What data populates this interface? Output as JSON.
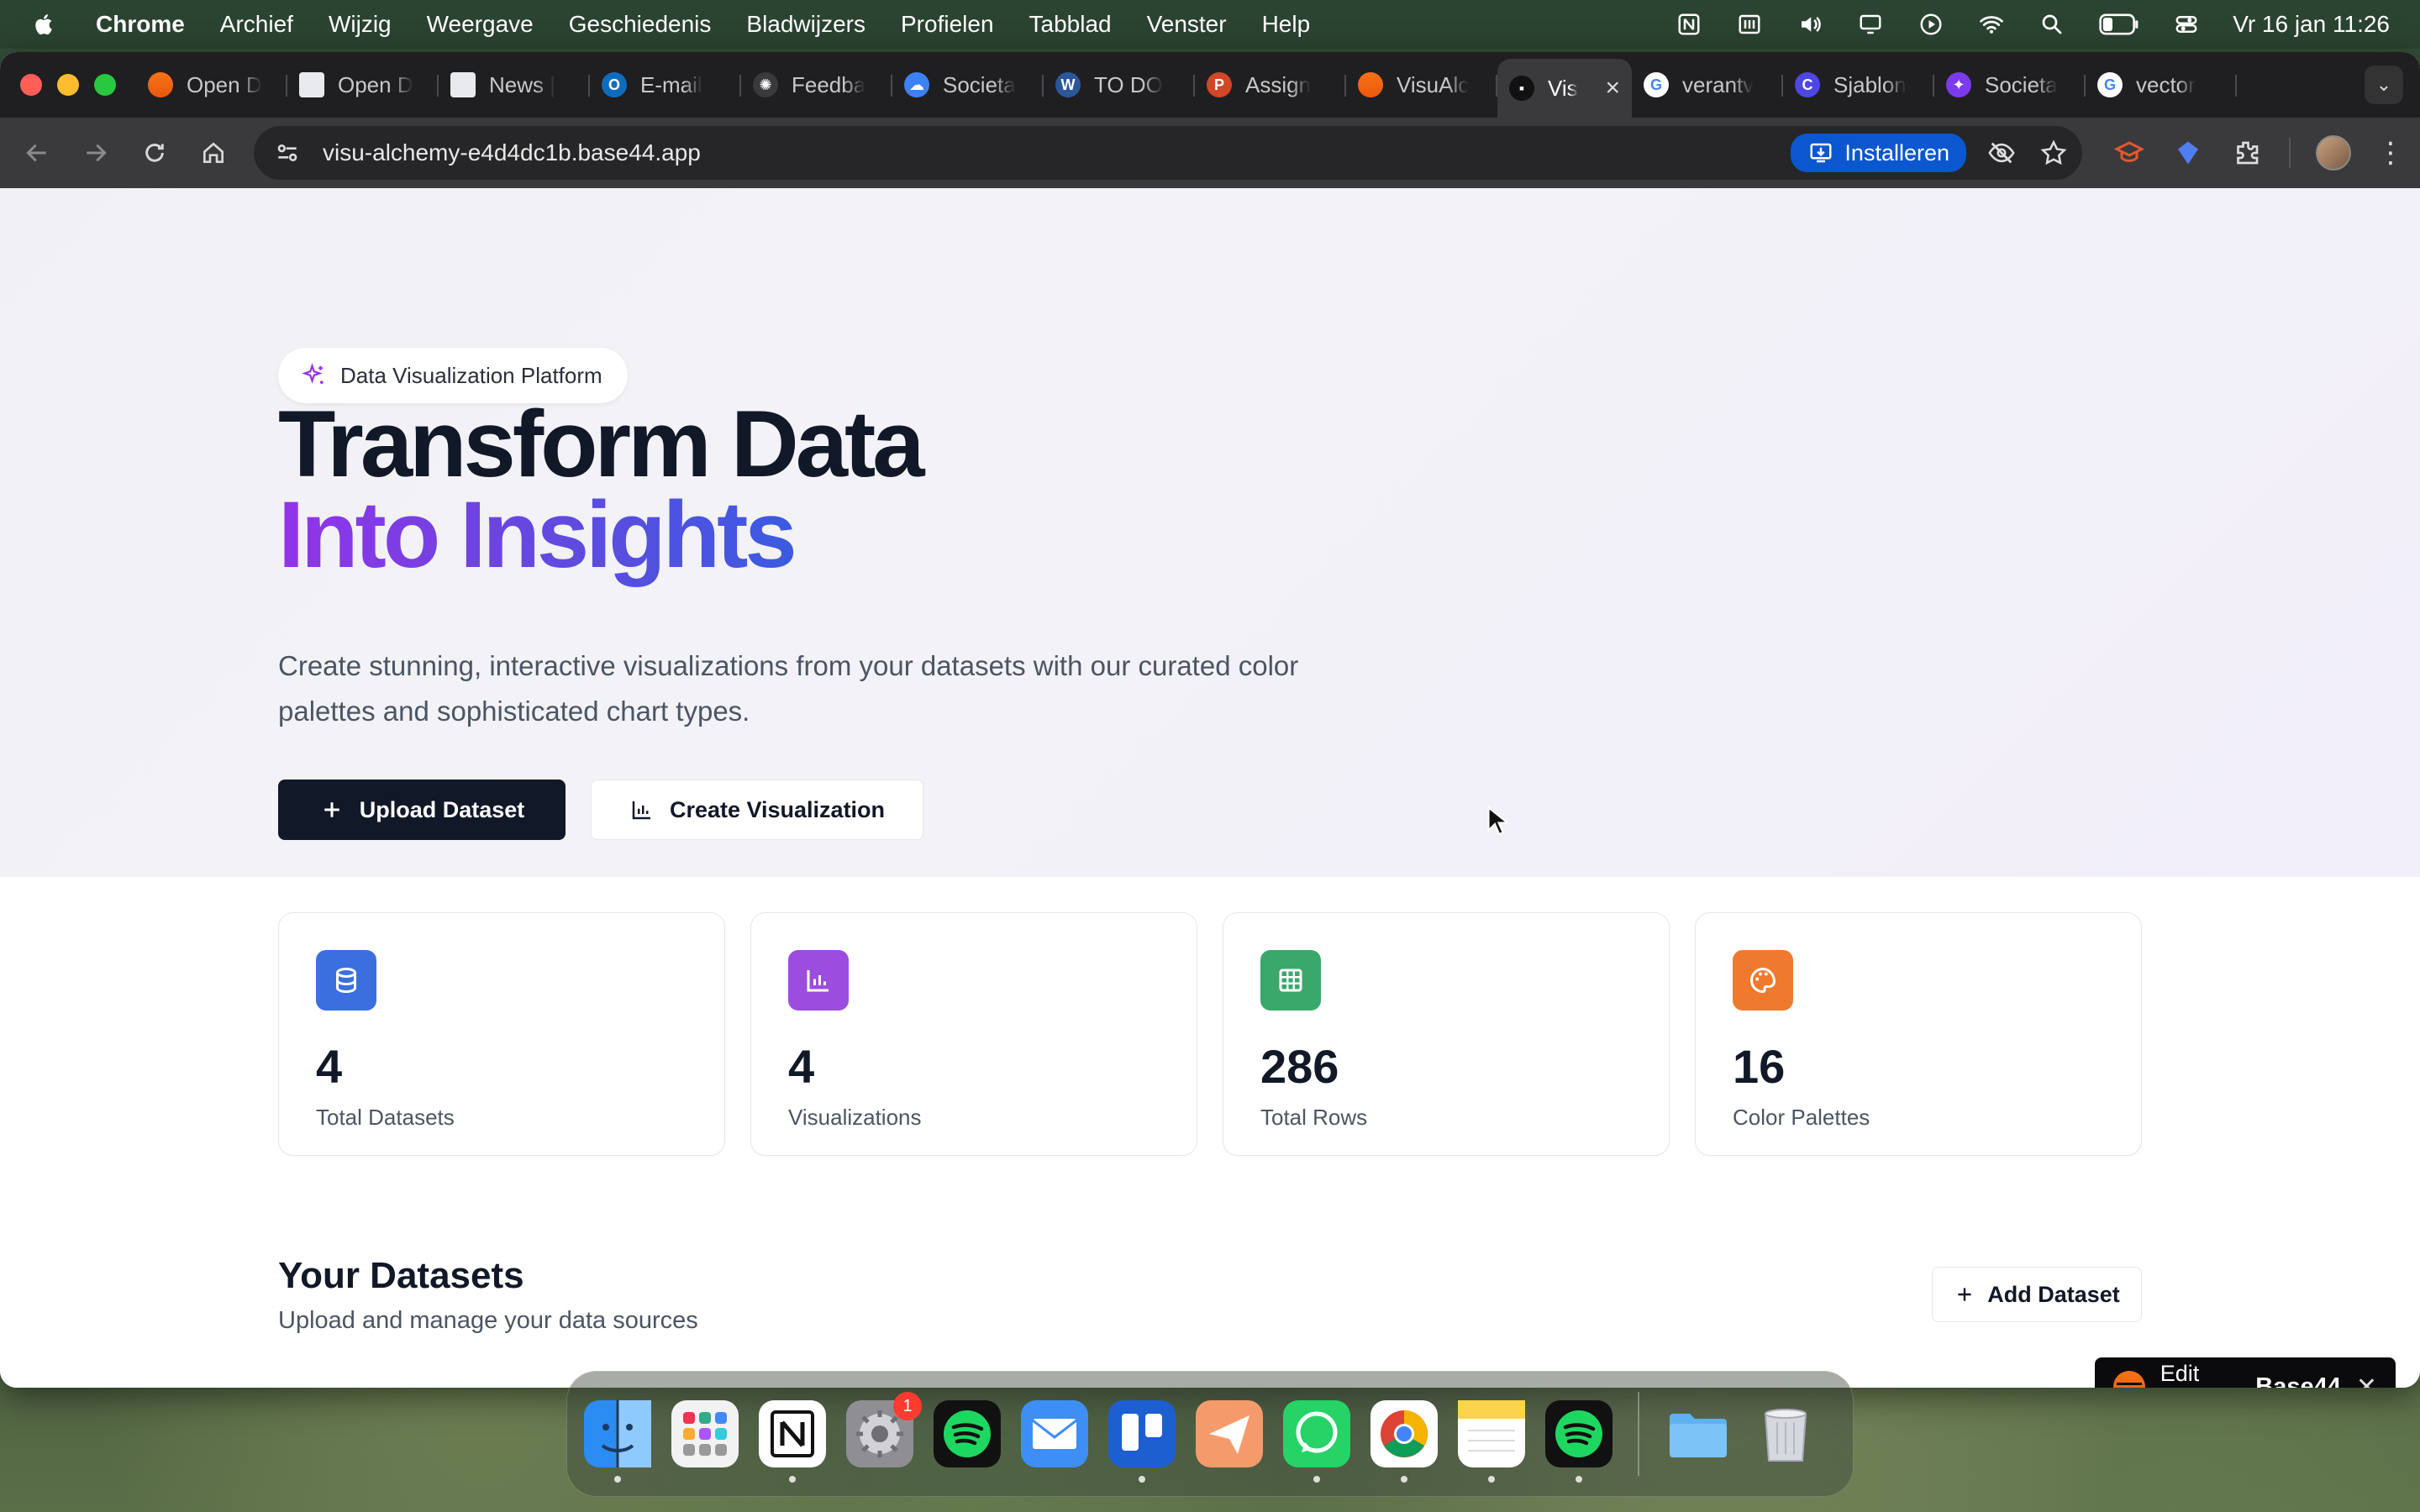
{
  "menubar": {
    "app_name": "Chrome",
    "items": [
      "Archief",
      "Wijzig",
      "Weergave",
      "Geschiedenis",
      "Bladwijzers",
      "Profielen",
      "Tabblad",
      "Venster",
      "Help"
    ],
    "clock": "Vr 16 jan  11:26",
    "status_icons": [
      "notion-icon",
      "display-icon",
      "volume-icon",
      "screen-mirroring-icon",
      "play-icon",
      "wifi-icon",
      "spotlight-icon",
      "battery-icon",
      "control-center-icon"
    ]
  },
  "browser": {
    "tabs": [
      {
        "label": "Open D",
        "icon": "base44-icon",
        "color": "#e4572e"
      },
      {
        "label": "Open D",
        "icon": "doc-icon",
        "color": "#9aa0a6"
      },
      {
        "label": "News |",
        "icon": "doc-icon",
        "color": "#9aa0a6"
      },
      {
        "label": "E-mail",
        "icon": "outlook-icon",
        "color": "#0f6cbd"
      },
      {
        "label": "Feedba",
        "icon": "openai-icon",
        "color": "#3a3a3c"
      },
      {
        "label": "Societa",
        "icon": "onedrive-icon",
        "color": "#3b82f6"
      },
      {
        "label": "TO DO",
        "icon": "word-icon",
        "color": "#2b579a"
      },
      {
        "label": "Assign",
        "icon": "powerpoint-icon",
        "color": "#d24726"
      },
      {
        "label": "VisuAlc",
        "icon": "base44-icon",
        "color": "#e4572e"
      },
      {
        "label": "Vis",
        "icon": "visu-icon",
        "color": "#111111",
        "active": true
      },
      {
        "label": "verantv",
        "icon": "google-icon",
        "color": "#ffffff"
      },
      {
        "label": "Sjablon",
        "icon": "canva-icon",
        "color": "#4f46e5"
      },
      {
        "label": "Societa",
        "icon": "gemini-icon",
        "color": "#7c3aed"
      },
      {
        "label": "vector",
        "icon": "google-icon",
        "color": "#ffffff"
      }
    ],
    "url": "visu-alchemy-e4d4dc1b.base44.app",
    "install_label": "Installeren"
  },
  "page": {
    "badge": "Data Visualization Platform",
    "title_line1": "Transform Data",
    "title_line2": "Into Insights",
    "description": "Create stunning, interactive visualizations from your datasets with our curated color palettes and sophisticated chart types.",
    "upload_button": "Upload Dataset",
    "create_button": "Create Visualization",
    "stats": [
      {
        "value": "4",
        "label": "Total Datasets",
        "icon": "database-icon",
        "color": "#3b6fe0"
      },
      {
        "value": "4",
        "label": "Visualizations",
        "icon": "bar-chart-icon",
        "color": "#9b4de0"
      },
      {
        "value": "286",
        "label": "Total Rows",
        "icon": "table-icon",
        "color": "#3aa86b"
      },
      {
        "value": "16",
        "label": "Color Palettes",
        "icon": "palette-icon",
        "color": "#ef7a2e"
      }
    ],
    "datasets_title": "Your Datasets",
    "datasets_subtitle": "Upload and manage your data sources",
    "add_dataset_button": "Add Dataset",
    "edit_badge_text": "Edit with",
    "edit_badge_brand": "Base44"
  },
  "dock": {
    "apps": [
      "finder-icon",
      "launchpad-icon",
      "notion-icon",
      "system-settings-icon",
      "spotify-icon",
      "mail-icon",
      "trello-icon",
      "paperplane-icon",
      "whatsapp-icon",
      "chrome-icon",
      "notes-icon",
      "spotify-icon",
      "folder-icon",
      "trash-icon"
    ],
    "settings_badge": "1"
  }
}
